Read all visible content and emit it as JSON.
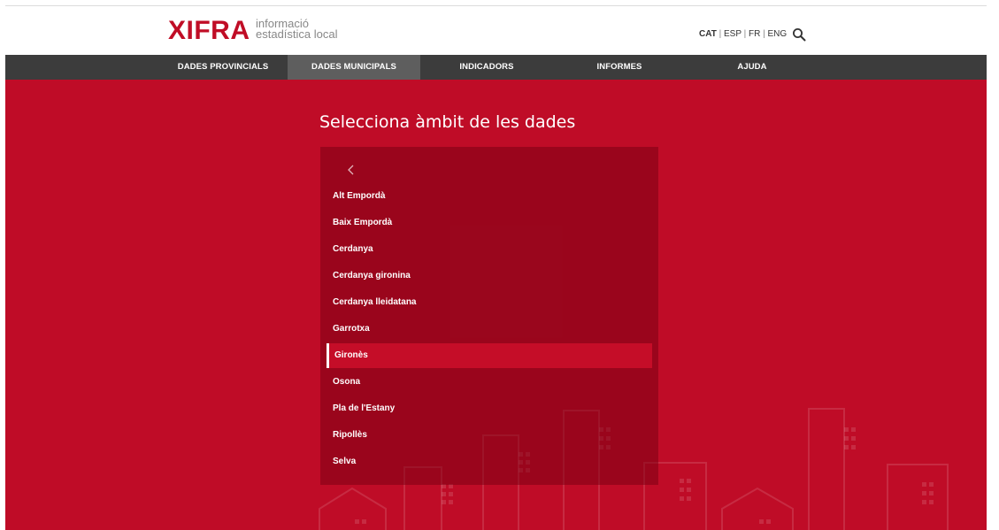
{
  "header": {
    "logo_text": "XIFRA",
    "logo_sub_line1": "informació",
    "logo_sub_line2": "estadística local",
    "languages": [
      "CAT",
      "ESP",
      "FR",
      "ENG"
    ],
    "language_separator": "|",
    "current_language": "CAT",
    "search_icon": "search-icon"
  },
  "nav": {
    "items": [
      {
        "label": "DADES PROVINCIALS",
        "active": false
      },
      {
        "label": "DADES MUNICIPALS",
        "active": true
      },
      {
        "label": "INDICADORS",
        "active": false
      },
      {
        "label": "INFORMES",
        "active": false
      },
      {
        "label": "AJUDA",
        "active": false
      }
    ]
  },
  "main": {
    "title": "Selecciona àmbit de les dades",
    "back_icon": "chevron-left-icon",
    "regions": [
      {
        "label": "Alt Empordà",
        "selected": false
      },
      {
        "label": "Baix Empordà",
        "selected": false
      },
      {
        "label": "Cerdanya",
        "selected": false
      },
      {
        "label": "Cerdanya gironina",
        "selected": false
      },
      {
        "label": "Cerdanya lleidatana",
        "selected": false
      },
      {
        "label": "Garrotxa",
        "selected": false
      },
      {
        "label": "Gironès",
        "selected": true
      },
      {
        "label": "Osona",
        "selected": false
      },
      {
        "label": "Pla de l'Estany",
        "selected": false
      },
      {
        "label": "Ripollès",
        "selected": false
      },
      {
        "label": "Selva",
        "selected": false
      }
    ]
  },
  "colors": {
    "brand_red": "#bf0c27",
    "logo_red": "#c00d26",
    "nav_bg": "#3c3c3c",
    "nav_active_bg": "#5e5e5e",
    "selected_item_bg": "#c50d28"
  }
}
